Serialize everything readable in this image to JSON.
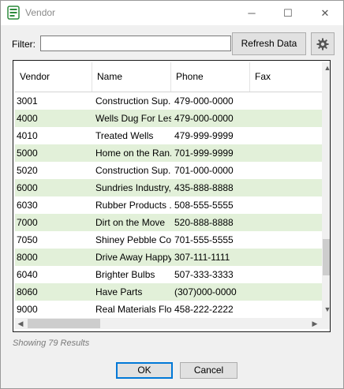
{
  "window": {
    "title": "Vendor",
    "icon": "vendor-app-icon"
  },
  "controls": {
    "minimize": "─",
    "maximize": "☐",
    "close": "✕"
  },
  "filter": {
    "label": "Filter:",
    "value": "",
    "placeholder": ""
  },
  "toolbar": {
    "refresh_label": "Refresh Data",
    "settings_icon": "gear-icon"
  },
  "grid": {
    "columns": [
      "Vendor",
      "Name",
      "Phone",
      "Fax"
    ],
    "rows": [
      {
        "vendor": "3001",
        "name": "Construction Sup...",
        "phone": "479-000-0000",
        "fax": ""
      },
      {
        "vendor": "4000",
        "name": "Wells Dug For Less",
        "phone": "479-000-0000",
        "fax": ""
      },
      {
        "vendor": "4010",
        "name": "Treated Wells",
        "phone": "479-999-9999",
        "fax": ""
      },
      {
        "vendor": "5000",
        "name": "Home on the Ran...",
        "phone": "701-999-9999",
        "fax": ""
      },
      {
        "vendor": "5020",
        "name": "Construction Sup...",
        "phone": "701-000-0000",
        "fax": ""
      },
      {
        "vendor": "6000",
        "name": "Sundries Industry,...",
        "phone": "435-888-8888",
        "fax": ""
      },
      {
        "vendor": "6030",
        "name": "Rubber Products ...",
        "phone": "508-555-5555",
        "fax": ""
      },
      {
        "vendor": "7000",
        "name": "Dirt on the Move",
        "phone": "520-888-8888",
        "fax": ""
      },
      {
        "vendor": "7050",
        "name": "Shiney Pebble Co...",
        "phone": "701-555-5555",
        "fax": ""
      },
      {
        "vendor": "8000",
        "name": "Drive Away Happy",
        "phone": "307-111-1111",
        "fax": ""
      },
      {
        "vendor": "6040",
        "name": "Brighter Bulbs",
        "phone": "507-333-3333",
        "fax": ""
      },
      {
        "vendor": "8060",
        "name": "Have Parts",
        "phone": "(307)000-0000",
        "fax": ""
      },
      {
        "vendor": "9000",
        "name": "Real Materials Flo...",
        "phone": "458-222-2222",
        "fax": ""
      }
    ]
  },
  "colors": {
    "alt_row": "#e2f0d9",
    "accent": "#0078d7"
  },
  "status": {
    "results_text": "Showing 79 Results"
  },
  "dialog": {
    "ok_label": "OK",
    "cancel_label": "Cancel"
  }
}
